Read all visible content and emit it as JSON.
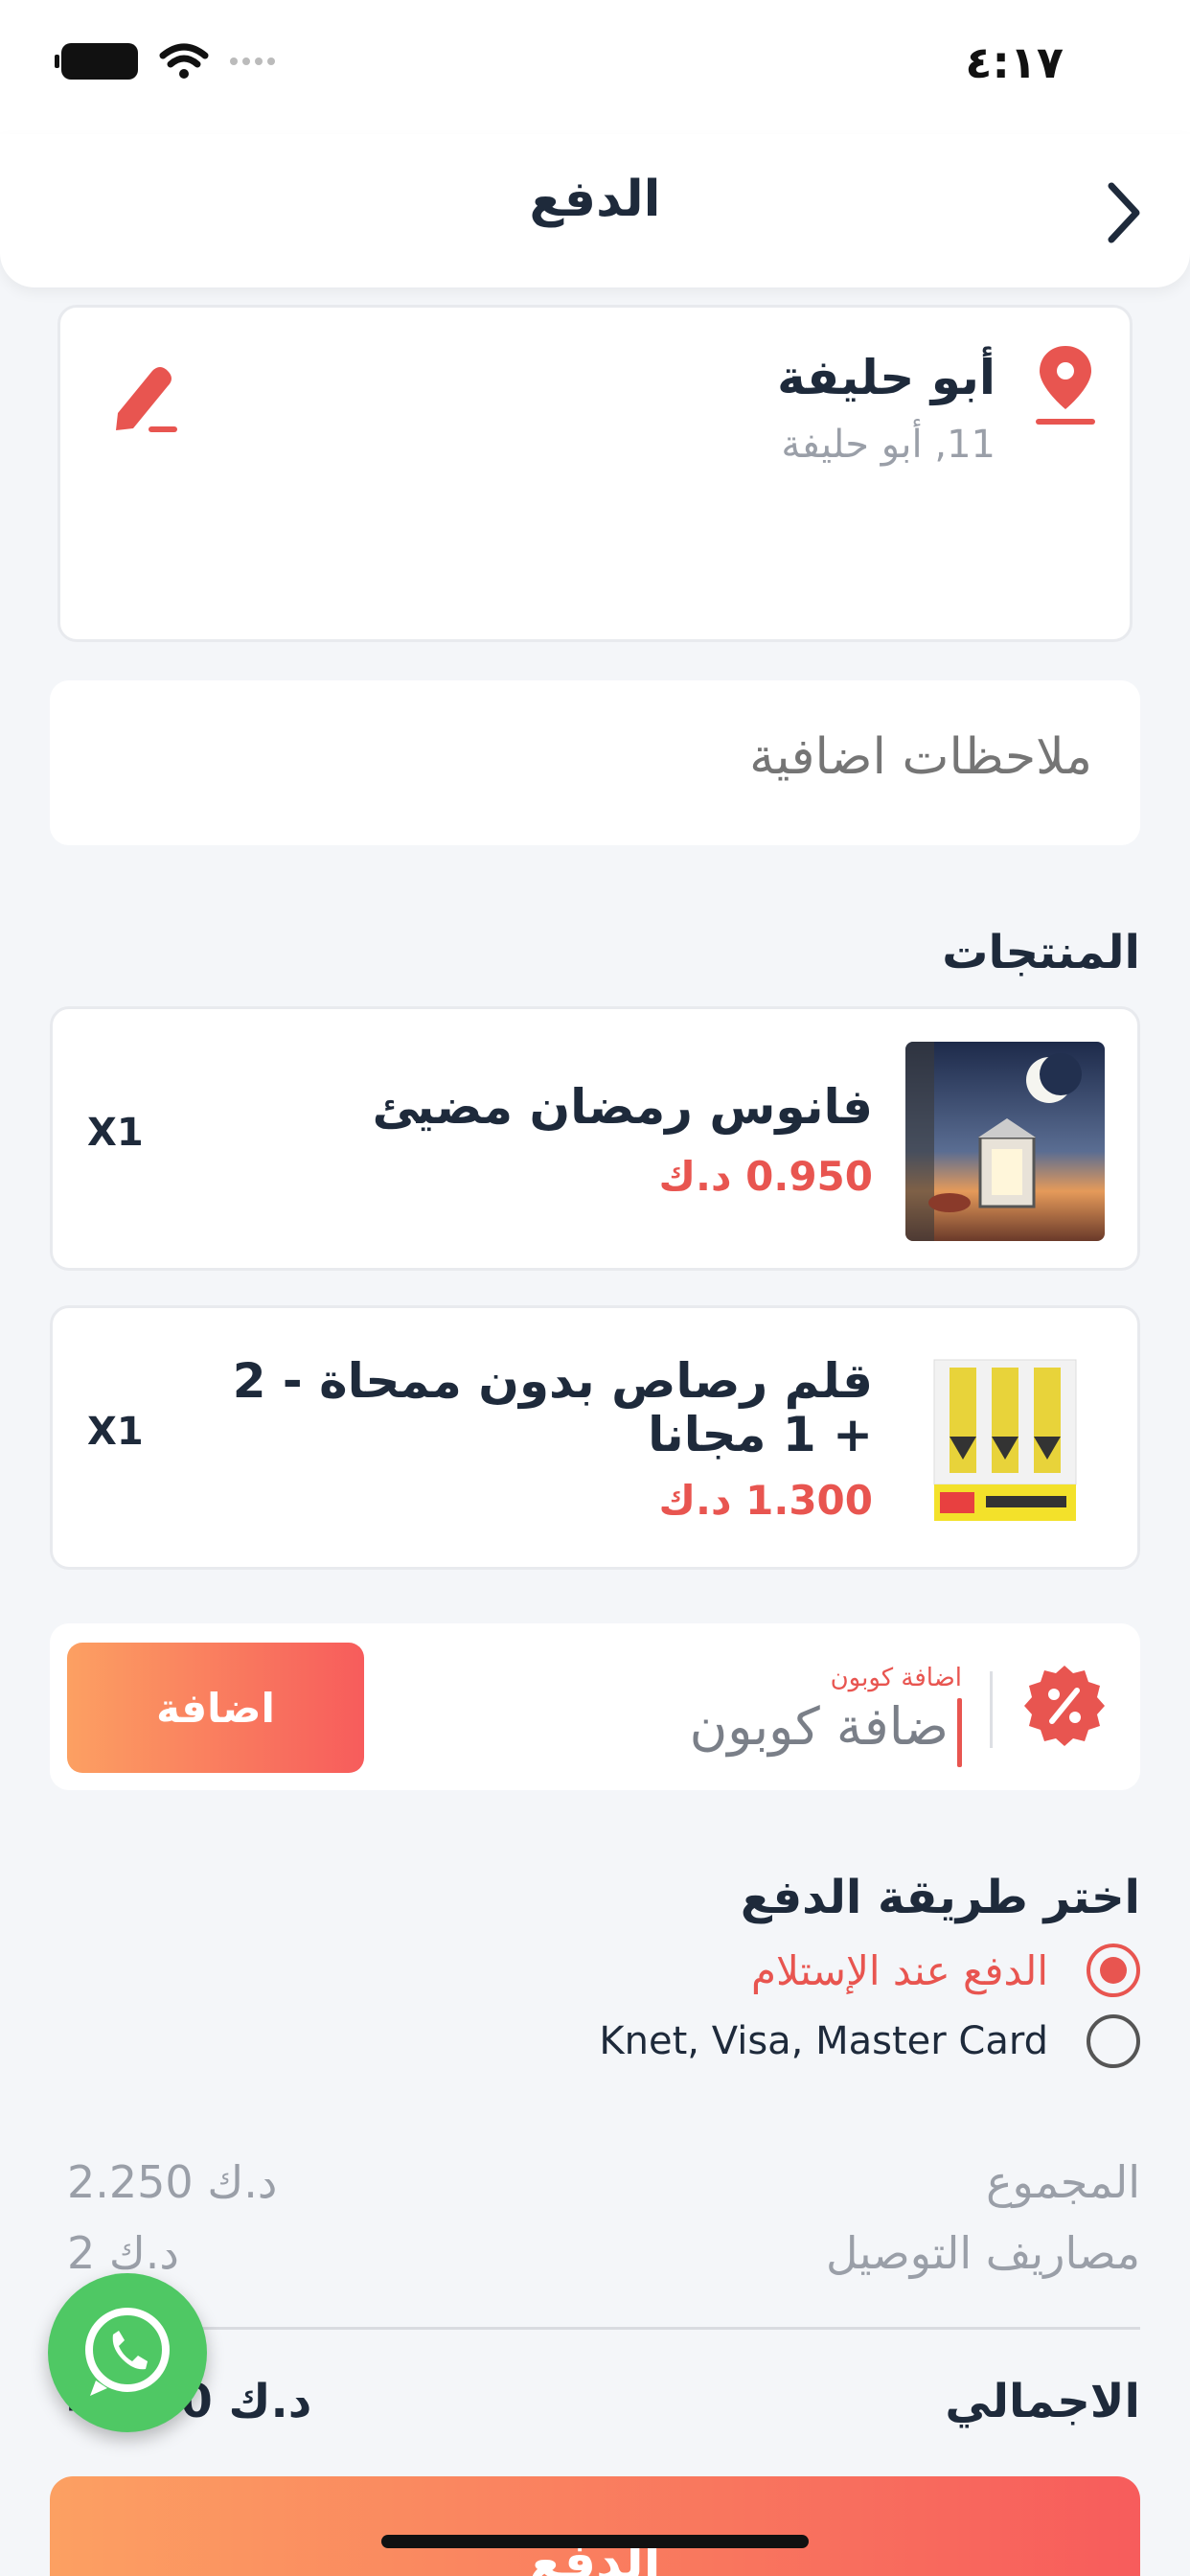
{
  "status_bar": {
    "time": "٤:١٧"
  },
  "header": {
    "title": "الدفع"
  },
  "address": {
    "name": "أبو حليفة",
    "details": "11, أبو حليفة"
  },
  "notes": {
    "placeholder": "ملاحظات اضافية"
  },
  "products_section": {
    "title": "المنتجات",
    "items": [
      {
        "name": "فانوس رمضان مضيئ",
        "price": "0.950 د.ك",
        "qty": "X1"
      },
      {
        "name": "قلم رصاص بدون ممحاة - 2 + 1 مجانا",
        "price": "1.300 د.ك",
        "qty": "X1"
      }
    ]
  },
  "coupon": {
    "label": "اضافة كوبون",
    "placeholder": "ضافة كوبون",
    "button": "اضافة"
  },
  "payment": {
    "title": "اختر طريقة الدفع",
    "options": [
      {
        "label": "الدفع عند الإستلام",
        "selected": true
      },
      {
        "label": "Knet, Visa,  Master Card",
        "selected": false
      }
    ]
  },
  "summary": {
    "subtotal_label": "المجموع",
    "subtotal_value": "2.250 د.ك",
    "delivery_label": "مصاريف التوصيل",
    "delivery_value": "2 د.ك",
    "total_label": "الاجمالي",
    "total_value": "4.250 د.ك"
  },
  "pay_button": {
    "label": "الدفع"
  },
  "colors": {
    "accent": "#e85550",
    "gradient_start": "#fca062",
    "gradient_end": "#f75c5c",
    "whatsapp": "#4fc864"
  }
}
